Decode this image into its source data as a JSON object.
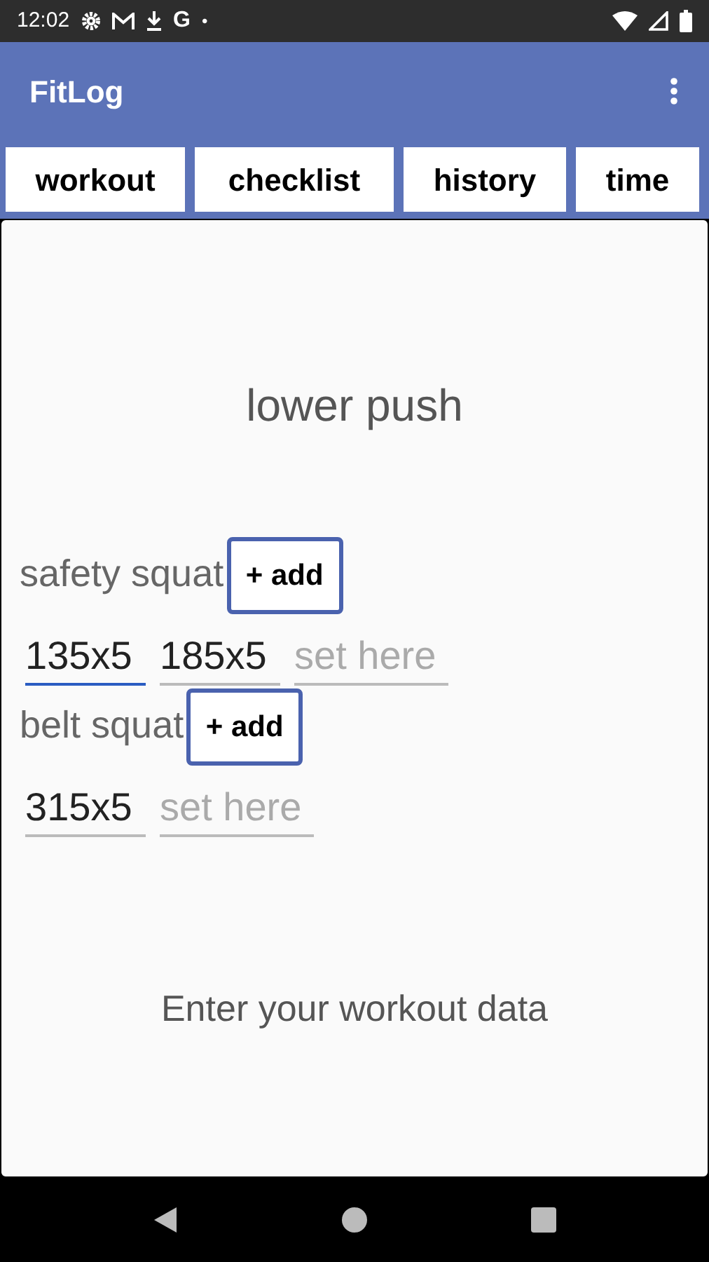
{
  "status_bar": {
    "time": "12:02",
    "g_glyph": "G",
    "dot": "•"
  },
  "app_bar": {
    "title": "FitLog"
  },
  "tabs": [
    {
      "label": "workout",
      "selected": false
    },
    {
      "label": "checklist",
      "selected": false
    },
    {
      "label": "history",
      "selected": false
    },
    {
      "label": "time",
      "selected": false
    }
  ],
  "workout_title": "lower push",
  "exercises": [
    {
      "name": "safety squat",
      "add_label": "+ add",
      "sets": [
        {
          "value": "135x5",
          "focused": true
        },
        {
          "value": "185x5",
          "focused": false
        }
      ],
      "placeholder": "set here"
    },
    {
      "name": "belt squat",
      "add_label": "+ add",
      "sets": [
        {
          "value": "315x5",
          "focused": false
        }
      ],
      "placeholder": "set here"
    }
  ],
  "footer": "Enter your workout data"
}
